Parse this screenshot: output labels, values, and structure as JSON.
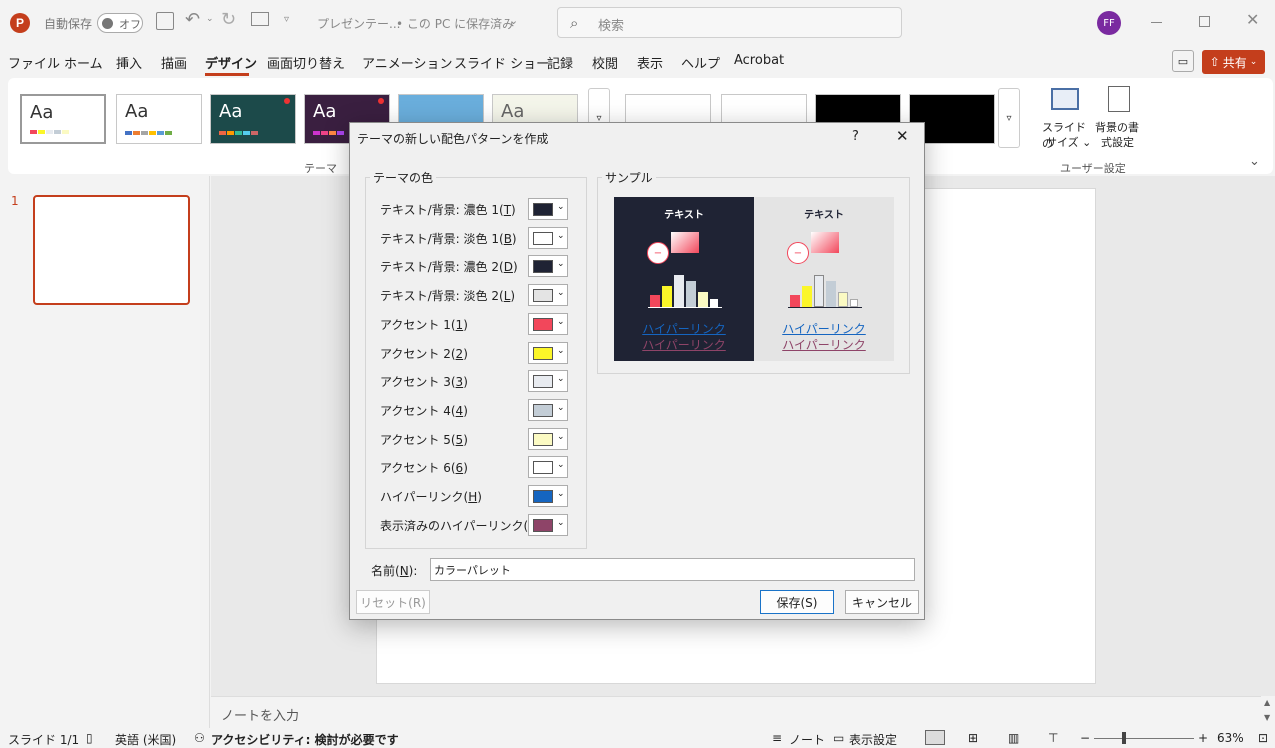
{
  "titlebar": {
    "autosave_label": "自動保存",
    "autosave_state": "オフ",
    "filename": "プレゼンテー...",
    "save_status": "• この PC に保存済み",
    "search_placeholder": "検索",
    "avatar": "FF"
  },
  "menu": {
    "items": [
      "ファイル",
      "ホーム",
      "挿入",
      "描画",
      "デザイン",
      "画面切り替え",
      "アニメーション",
      "スライド ショー",
      "記録",
      "校閲",
      "表示",
      "ヘルプ",
      "Acrobat"
    ],
    "active": "デザイン",
    "share": "共有"
  },
  "ribbon": {
    "themes_label": "テーマ",
    "theme_aa": "Aa",
    "slide_size": [
      "スライドの",
      "サイズ ⌄"
    ],
    "bg_format": [
      "背景の書",
      "式設定"
    ],
    "user_settings": "ユーザー設定"
  },
  "slides": {
    "number": "1"
  },
  "notes": {
    "placeholder": "ノートを入力"
  },
  "status": {
    "slide": "スライド 1/1",
    "language": "英語 (米国)",
    "accessibility": "アクセシビリティ: 検討が必要です",
    "notes": "ノート",
    "view_settings": "表示設定",
    "zoom": "63%"
  },
  "dialog": {
    "title": "テーマの新しい配色パターンを作成",
    "help": "?",
    "theme_colors_label": "テーマの色",
    "sample_label": "サンプル",
    "colors": [
      {
        "label": "テキスト/背景: 濃色 1(",
        "key": "T",
        "color": "#1f2334"
      },
      {
        "label": "テキスト/背景: 淡色 1(",
        "key": "B",
        "color": "#ffffff"
      },
      {
        "label": "テキスト/背景: 濃色 2(",
        "key": "D",
        "color": "#1f2334"
      },
      {
        "label": "テキスト/背景: 淡色 2(",
        "key": "L",
        "color": "#e4e4e4"
      },
      {
        "label": "アクセント 1(",
        "key": "1",
        "color": "#f2475b"
      },
      {
        "label": "アクセント 2(",
        "key": "2",
        "color": "#fbf629"
      },
      {
        "label": "アクセント 3(",
        "key": "3",
        "color": "#e8ebf0"
      },
      {
        "label": "アクセント 4(",
        "key": "4",
        "color": "#c3cdd6"
      },
      {
        "label": "アクセント 5(",
        "key": "5",
        "color": "#fbfac3"
      },
      {
        "label": "アクセント 6(",
        "key": "6",
        "color": "#ffffff"
      },
      {
        "label": "ハイパーリンク(",
        "key": "H",
        "color": "#1565c0"
      },
      {
        "label": "表示済みのハイパーリンク(",
        "key": "F",
        "color": "#8e4468"
      }
    ],
    "sample": {
      "text": "テキスト",
      "link": "ハイパーリンク",
      "visited": "ハイパーリンク"
    },
    "name_label": "名前(",
    "name_key": "N",
    "name_suffix": "):",
    "name_value": "カラーパレット",
    "reset": "リセット(R)",
    "save": "保存(S)",
    "cancel": "キャンセル"
  }
}
